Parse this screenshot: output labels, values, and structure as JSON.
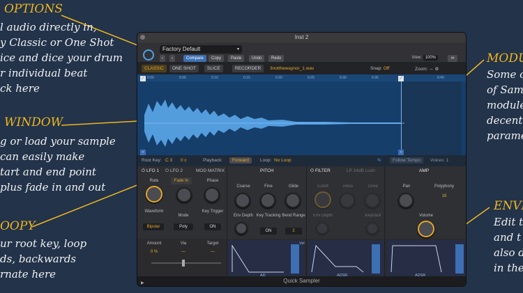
{
  "annotations": {
    "options": {
      "title": "OPTIONS",
      "lines": [
        "l audio directly in,",
        "y Classic or One Shot",
        "ice and dice your drum",
        "r individual beat",
        "ck here"
      ]
    },
    "window": {
      "title": "WINDOW",
      "lines": [
        "g or load your sample",
        "can easily make",
        "tart and end point",
        "plus fade in and out"
      ]
    },
    "loop": {
      "title": "OOPY",
      "lines": [
        "ur root key, loop",
        "ds, backwards",
        "rnate here"
      ]
    },
    "modules": {
      "title": "MODU",
      "lines": [
        "Some o",
        "of Sam",
        "module",
        "decent",
        "parame"
      ]
    },
    "envelope": {
      "title": "ENVE",
      "lines": [
        "Edit t",
        "and t",
        "also d",
        "in the"
      ]
    }
  },
  "window": {
    "title": "Inst 2",
    "preset": "Factory Default",
    "toolbar": {
      "compare": "Compare",
      "copy": "Copy",
      "paste": "Paste",
      "undo": "Undo",
      "redo": "Redo",
      "view_label": "View:",
      "view_value": "100%"
    },
    "modes": {
      "classic": "CLASSIC",
      "one_shot": "ONE SHOT",
      "slice": "SLICE",
      "recorder": "RECORDER",
      "filename": "3notthewaynor_1.wav",
      "snap_label": "Snap:",
      "snap_value": "Off",
      "zoom_label": "Zoom:"
    },
    "ruler": [
      "0:00",
      "0:05",
      "0:10",
      "0:15",
      "0:20",
      "0:25",
      "0:30",
      "0:35",
      "0:40"
    ],
    "info": {
      "root_key_label": "Root Key:",
      "root_key_value": "C 3",
      "root_key_cents": "0 c",
      "playback_label": "Playback:",
      "playback_value": "Forward",
      "loop_label": "Loop:",
      "loop_value": "No Loop",
      "follow_tempo": "Follow Tempo",
      "voices": "Voices: 1"
    },
    "lfo": {
      "tab1": "LFO 1",
      "tab2": "LFO 2",
      "tab3": "MOD MATRIX",
      "rate": "Rate",
      "fade_in": "Fade In",
      "phase": "Phase",
      "waveform": "Waveform",
      "waveform_value": "Bipolar",
      "mode": "Mode",
      "mode_value": "Poly",
      "key_trigger": "Key Trigger",
      "key_trigger_value": "ON",
      "amount": "Amount",
      "amount_value": "0 %",
      "via": "Via",
      "via_value": "—",
      "target": "Target",
      "target_value": "—"
    },
    "pitch": {
      "title": "PITCH",
      "coarse": "Coarse",
      "fine": "Fine",
      "glide": "Glide",
      "env_depth": "Env Depth",
      "key_tracking": "Key Tracking",
      "key_tracking_value": "ON",
      "bend_range": "Bend Range",
      "bend_value": "2"
    },
    "filter": {
      "title": "FILTER",
      "type": "LP 24dB Lush",
      "cutoff": "Cutoff",
      "reso": "Reso",
      "drive": "Drive",
      "env_depth": "Env Depth",
      "keytrack": "Keytrack"
    },
    "amp": {
      "title": "AMP",
      "pan": "Pan",
      "polyphony": "Polyphony",
      "polyphony_value": "16",
      "volume": "Volume"
    },
    "env_labels": {
      "ad": "AD",
      "adsr1": "ADSR",
      "adsr2": "ADSR",
      "vel": "Vel"
    },
    "footer": "Quick Sampler"
  }
}
